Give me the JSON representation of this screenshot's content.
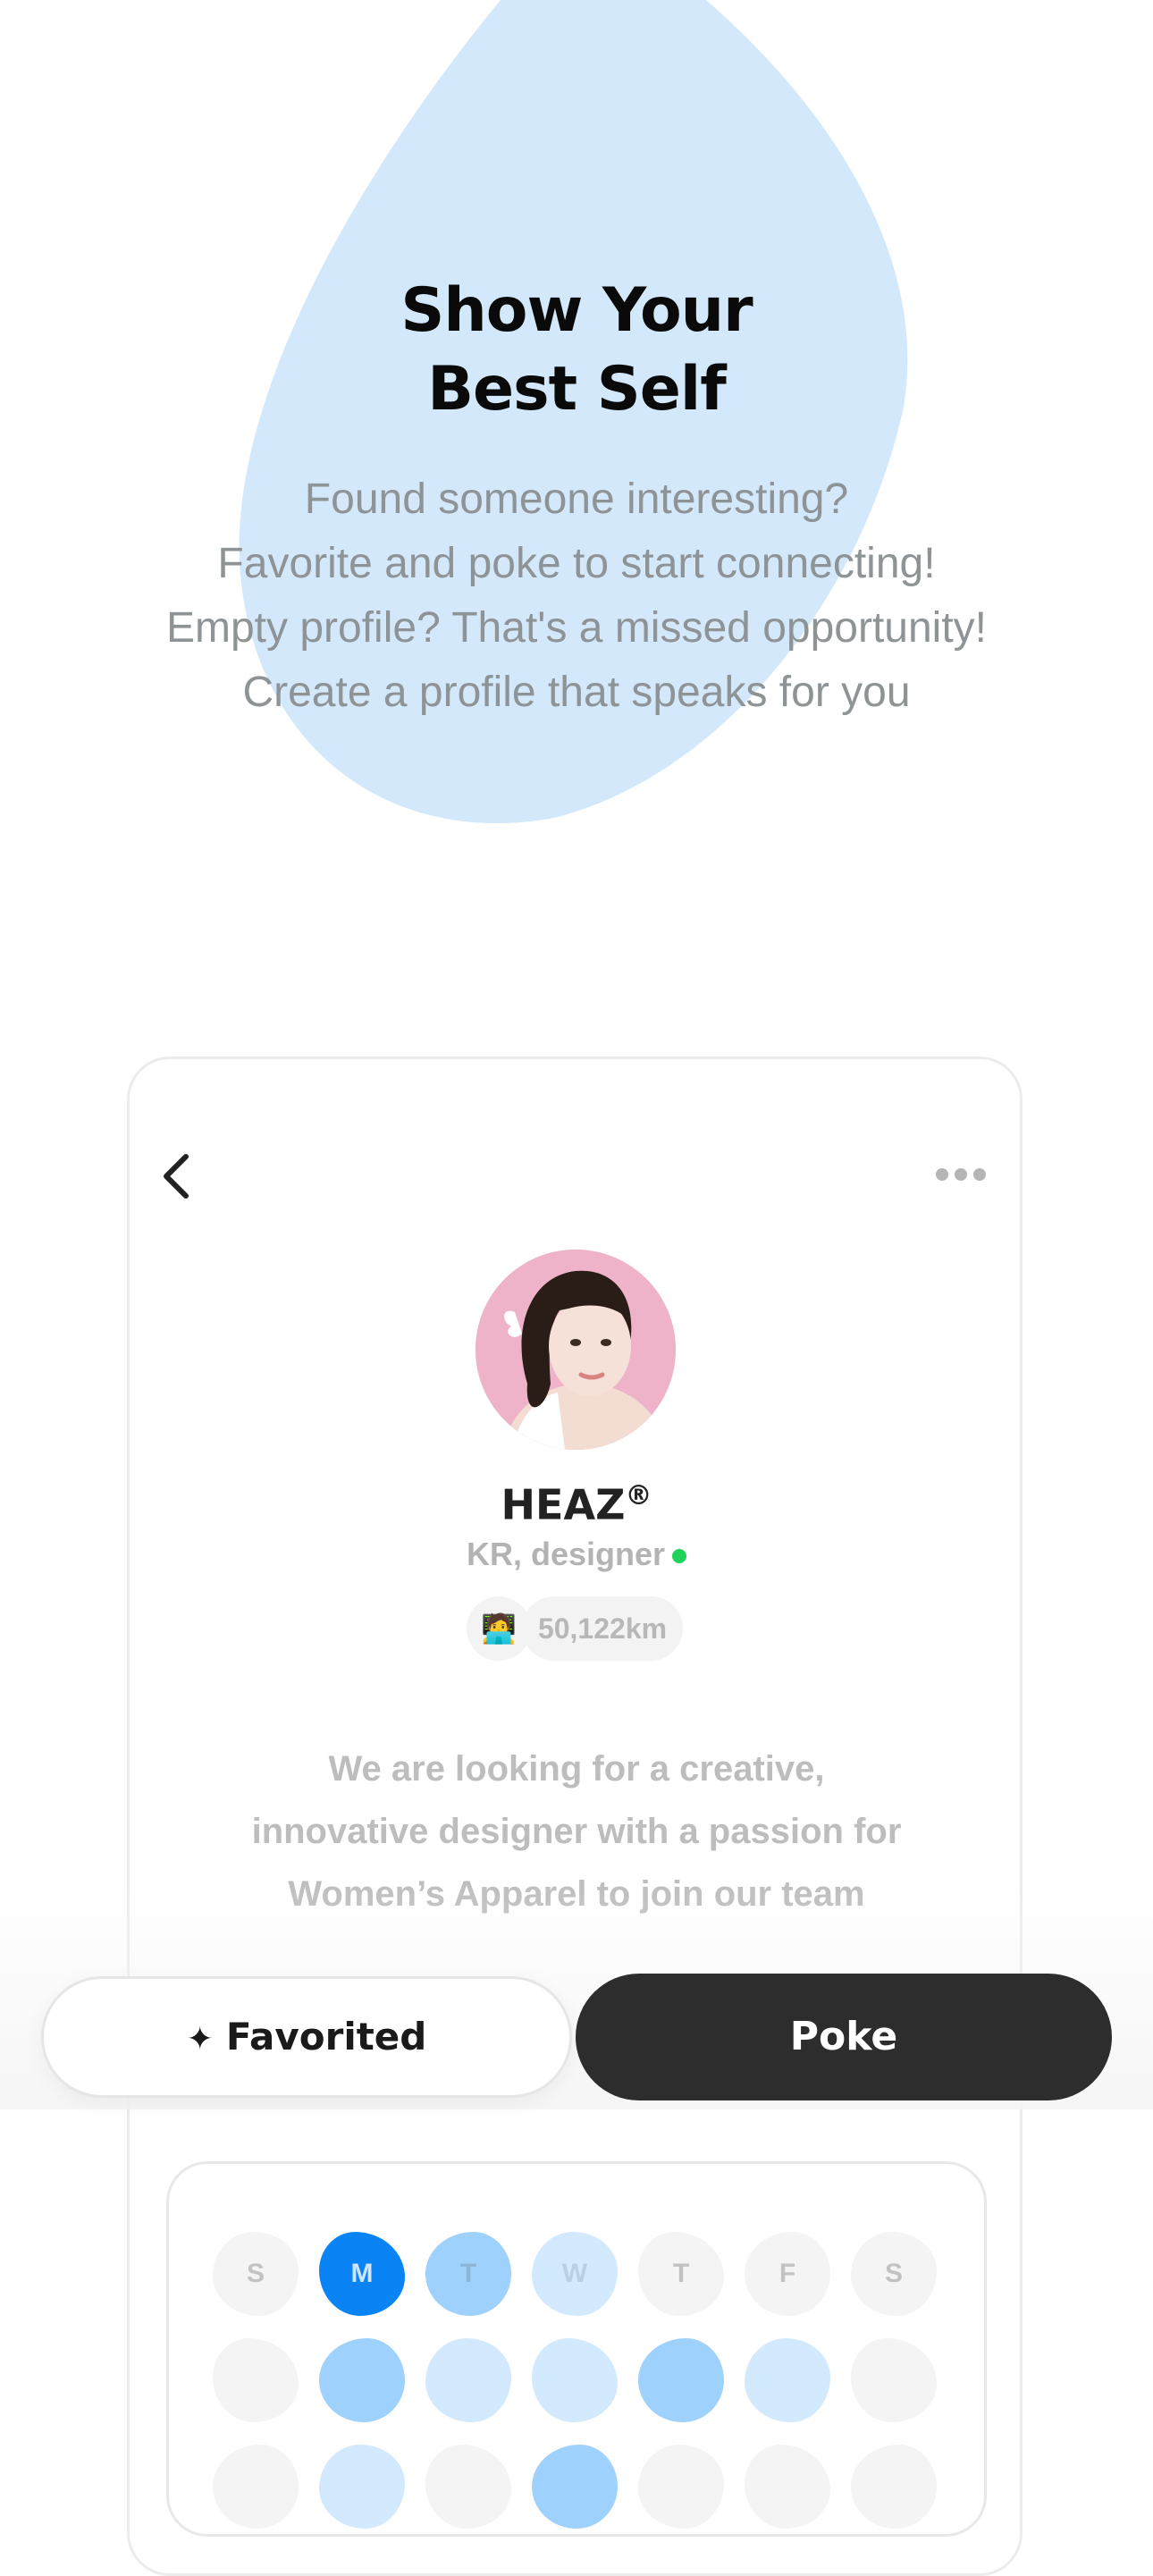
{
  "hero": {
    "title_line1": "Show Your",
    "title_line2": "Best Self",
    "subtitle_lines": [
      "Found someone interesting?",
      "Favorite and poke to start connecting!",
      "Empty profile? That's a missed opportunity!",
      "Create a profile that speaks for you"
    ],
    "blob_color": "#d3e9fb"
  },
  "profile": {
    "name": "HEAZ",
    "name_mark": "®",
    "location_role": "KR, designer",
    "status_color": "#1fd35a",
    "distance_emoji": "🧑‍💻",
    "distance": "50,122km",
    "bio_lines": [
      "We are looking for a creative,",
      "innovative designer with a passion for",
      "Women’s Apparel to join our team"
    ],
    "icons": {
      "back": "back-chevron-icon",
      "more": "more-dots-icon"
    }
  },
  "actions": {
    "favorite_icon": "sparkle-icon",
    "favorite_label": "Favorited",
    "poke_label": "Poke"
  },
  "availability": {
    "day_labels": [
      "S",
      "M",
      "T",
      "W",
      "T",
      "F",
      "S"
    ],
    "levels": [
      [
        0,
        3,
        2,
        1,
        0,
        0,
        0
      ],
      [
        0,
        2,
        1,
        1,
        2,
        1,
        0
      ],
      [
        0,
        1,
        0,
        2,
        0,
        0,
        0
      ]
    ],
    "colors": [
      "#f4f4f4",
      "#d3e9fd",
      "#9fd1fd",
      "#0a84f5"
    ]
  }
}
